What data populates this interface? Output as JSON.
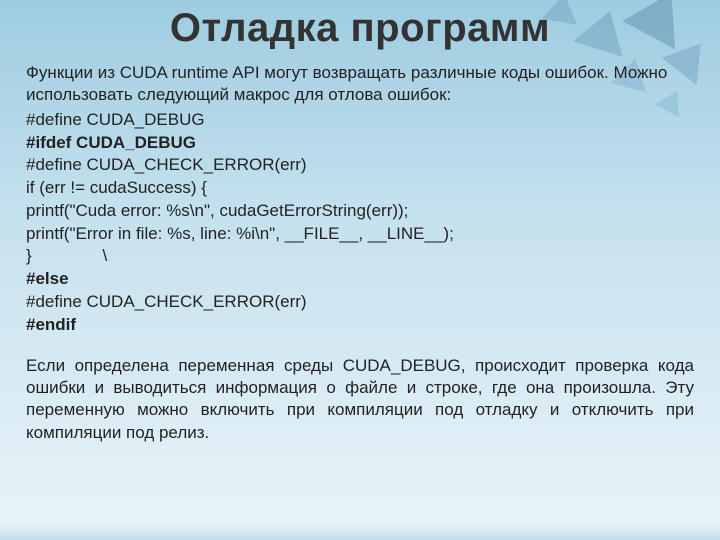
{
  "title": "Отладка программ",
  "intro": [
    "Функции из CUDA runtime API могут возвращать различные коды ошибок. Можно использовать следующий макрос для отлова ошибок:"
  ],
  "code": [
    {
      "text": "#define CUDA_DEBUG",
      "bold": false
    },
    {
      "text": "#ifdef CUDA_DEBUG",
      "bold": true
    },
    {
      "text": "#define CUDA_CHECK_ERROR(err)",
      "bold": false
    },
    {
      "text": "if (err != cudaSuccess) {",
      "bold": false
    },
    {
      "text": "printf(\"Cuda error: %s\\n\", cudaGetErrorString(err));",
      "bold": false
    },
    {
      "text": "printf(\"Error in file: %s, line: %i\\n\", __FILE__, __LINE__);",
      "bold": false
    },
    {
      "text": "}               \\",
      "bold": false
    },
    {
      "text": "#else",
      "bold": true
    },
    {
      "text": "#define CUDA_CHECK_ERROR(err)",
      "bold": false
    },
    {
      "text": "#endif",
      "bold": true
    }
  ],
  "after": "Если определена переменная среды CUDA_DEBUG, происходит проверка кода ошибки и выводиться информация о файле и строке, где она произошла. Эту переменную можно включить при компиляции под отладку и отключить при компиляции под релиз."
}
